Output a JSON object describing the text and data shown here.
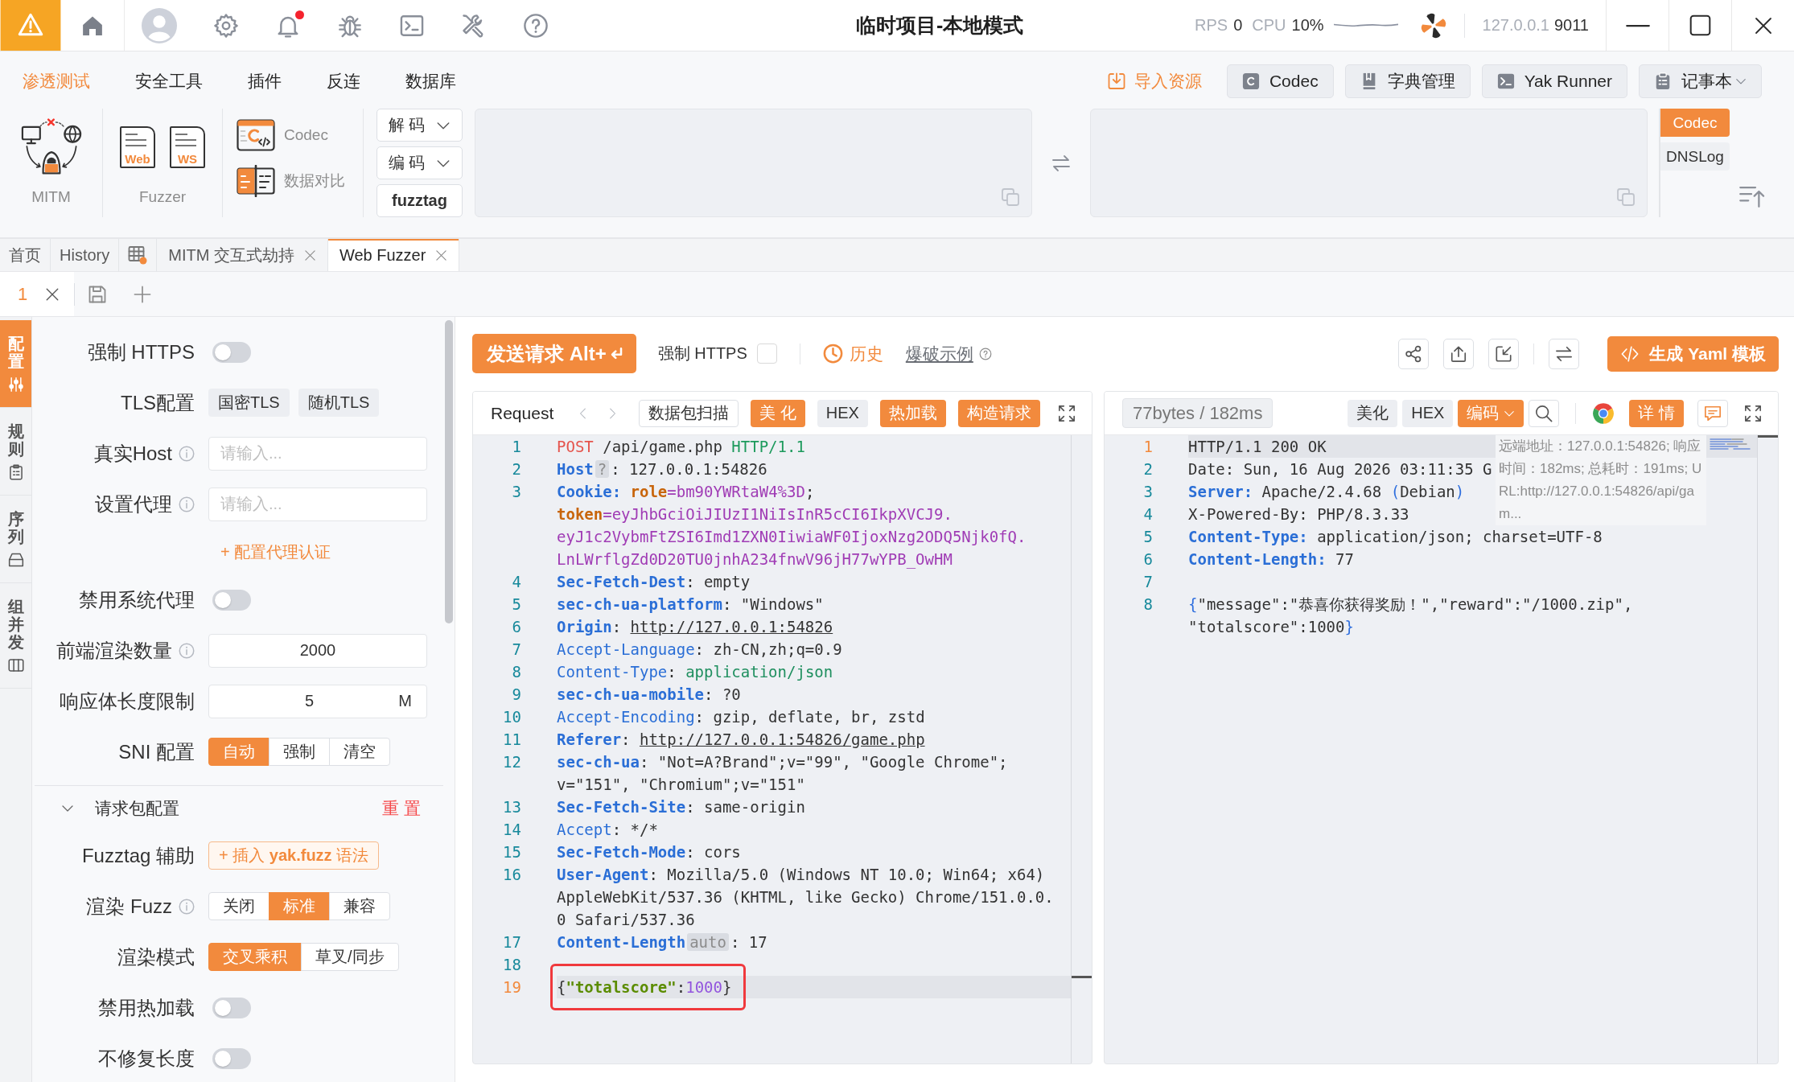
{
  "title_bar": {
    "title": "临时项目-本地模式",
    "unread_notifications": true,
    "stats": [
      {
        "label": "RPS",
        "value": "0"
      },
      {
        "label": "CPU",
        "value": "10%"
      }
    ],
    "engine": {
      "address": "127.0.0.1",
      "port": "9011"
    }
  },
  "menu": {
    "items": [
      {
        "label": "渗透测试",
        "selected": true
      },
      {
        "label": "安全工具",
        "selected": false
      },
      {
        "label": "插件",
        "selected": false
      },
      {
        "label": "反连",
        "selected": false
      },
      {
        "label": "数据库",
        "selected": false
      }
    ],
    "import_link": "导入资源",
    "buttons": [
      {
        "label": "Codec",
        "kind": "button"
      },
      {
        "label": "字典管理",
        "kind": "button"
      },
      {
        "label": "Yak Runner",
        "kind": "button"
      },
      {
        "label": "记事本",
        "kind": "dropdown"
      }
    ]
  },
  "toolbar": {
    "mitm": "MITM",
    "fuzzer": {
      "label": "Fuzzer",
      "items": [
        "Web",
        "WS"
      ]
    },
    "tools": [
      "Codec",
      "数据对比"
    ],
    "codec_actions": [
      {
        "label": "解 码",
        "kind": "dropdown"
      },
      {
        "label": "编 码",
        "kind": "dropdown"
      },
      {
        "label": "fuzztag",
        "kind": "button"
      }
    ],
    "side_tabs": [
      {
        "label": "Codec",
        "selected": true
      },
      {
        "label": "DNSLog",
        "selected": false
      }
    ]
  },
  "tabs": [
    {
      "kind": "text",
      "label": "首页",
      "selected": false,
      "closable": false
    },
    {
      "kind": "text",
      "label": "History",
      "selected": false,
      "closable": false
    },
    {
      "kind": "icon",
      "selected": false,
      "closable": false
    },
    {
      "kind": "text",
      "label": "MITM 交互式劫持",
      "selected": false,
      "closable": true
    },
    {
      "kind": "text",
      "label": "Web Fuzzer",
      "selected": true,
      "closable": true
    }
  ],
  "sub_tabs": [
    {
      "label": "1",
      "selected": true,
      "closable": true
    }
  ],
  "side_rail": [
    {
      "label": "配置",
      "selected": true
    },
    {
      "label": "规则",
      "selected": false
    },
    {
      "label": "序列",
      "selected": false
    },
    {
      "label": "组并发",
      "selected": false
    }
  ],
  "config": [
    {
      "kind": "toggle",
      "label": "强制 HTTPS",
      "on": false
    },
    {
      "kind": "chips",
      "label": "TLS配置",
      "options": [
        {
          "label": "国密TLS",
          "selected": false
        },
        {
          "label": "随机TLS",
          "selected": false
        }
      ]
    },
    {
      "kind": "input",
      "label": "真实Host",
      "info": true,
      "placeholder": "请输入..."
    },
    {
      "kind": "input",
      "label": "设置代理",
      "info": true,
      "placeholder": "请输入..."
    },
    {
      "kind": "link",
      "label": "+ 配置代理认证"
    },
    {
      "kind": "toggle",
      "label": "禁用系统代理",
      "on": false
    },
    {
      "kind": "input",
      "label": "前端渲染数量",
      "info": true,
      "value": "2000"
    },
    {
      "kind": "input",
      "label": "响应体长度限制",
      "value": "5",
      "suffix": "M"
    },
    {
      "kind": "segmented",
      "label": "SNI 配置",
      "options": [
        {
          "label": "自动",
          "selected": true
        },
        {
          "label": "强制",
          "selected": false
        },
        {
          "label": "清空",
          "selected": false
        }
      ]
    },
    {
      "kind": "section",
      "label": "请求包配置",
      "expanded": true,
      "action": "重 置"
    },
    {
      "kind": "button",
      "label": "Fuzztag 辅助",
      "button": [
        {
          "text": "+ 插入 ",
          "bold": false
        },
        {
          "text": "yak.fuzz",
          "bold": true
        },
        {
          "text": " 语法",
          "bold": false
        }
      ]
    },
    {
      "kind": "segmented",
      "label": "渲染 Fuzz",
      "info": true,
      "options": [
        {
          "label": "关闭",
          "selected": false
        },
        {
          "label": "标准",
          "selected": true
        },
        {
          "label": "兼容",
          "selected": false
        }
      ]
    },
    {
      "kind": "segmented",
      "label": "渲染模式",
      "options": [
        {
          "label": "交叉乘积",
          "selected": true
        },
        {
          "label": "草叉/同步",
          "selected": false
        }
      ]
    },
    {
      "kind": "toggle",
      "label": "禁用热加载",
      "on": false
    },
    {
      "kind": "toggle",
      "label": "不修复长度",
      "on": false
    }
  ],
  "send_bar": {
    "send_button": "发送请求 Alt+",
    "force_https": {
      "label": "强制 HTTPS",
      "checked": false
    },
    "history": "历史",
    "examples": "爆破示例",
    "yaml_button": "生成 Yaml 模板"
  },
  "request": {
    "title": "Request",
    "buttons": [
      {
        "label": "数据包扫描",
        "kind": "outline"
      },
      {
        "label": "美 化",
        "kind": "primary"
      },
      {
        "label": "HEX",
        "kind": "plain"
      },
      {
        "label": "热加载",
        "kind": "primary"
      },
      {
        "label": "构造请求",
        "kind": "primary"
      }
    ],
    "lines": [
      {
        "number": "1",
        "current": false,
        "boxed": false,
        "rows": [
          [
            {
              "kind": "method",
              "text": "POST"
            },
            {
              "kind": "plain",
              "text": " /api/game.php "
            },
            {
              "kind": "version",
              "text": "HTTP/1.1"
            }
          ]
        ]
      },
      {
        "number": "2",
        "current": false,
        "boxed": false,
        "rows": [
          [
            {
              "kind": "key_strong",
              "text": "Host"
            },
            {
              "kind": "hint",
              "text": "?"
            },
            {
              "kind": "plain",
              "text": ": 127.0.0.1:54826"
            }
          ]
        ]
      },
      {
        "number": "3",
        "current": false,
        "boxed": false,
        "rows": [
          [
            {
              "kind": "key_strong",
              "text": "Cookie:"
            },
            {
              "kind": "plain",
              "text": " "
            },
            {
              "kind": "cookie_name",
              "text": "role"
            },
            {
              "kind": "cookie_value",
              "text": "=bm90YWRtaW4%3D"
            },
            {
              "kind": "plain",
              "text": "; "
            }
          ],
          [
            {
              "kind": "cookie_name",
              "text": "token"
            },
            {
              "kind": "cookie_value",
              "text": "=eyJhbGciOiJIUzI1NiIsInR5cCI6IkpXVCJ9."
            }
          ],
          [
            {
              "kind": "cookie_value",
              "text": "eyJ1c2VybmFtZSI6Imd1ZXN0IiwiaWF0IjoxNzg2ODQ5Njk0fQ."
            }
          ],
          [
            {
              "kind": "cookie_value",
              "text": "LnLWrflgZd0D20TU0jnhA234fnwV96jH77wYPB_OwHM"
            }
          ]
        ]
      },
      {
        "number": "4",
        "current": false,
        "boxed": false,
        "rows": [
          [
            {
              "kind": "key_strong",
              "text": "Sec-Fetch-Dest"
            },
            {
              "kind": "plain",
              "text": ": empty"
            }
          ]
        ]
      },
      {
        "number": "5",
        "current": false,
        "boxed": false,
        "rows": [
          [
            {
              "kind": "key_strong",
              "text": "sec-ch-ua-platform"
            },
            {
              "kind": "plain",
              "text": ": \"Windows\""
            }
          ]
        ]
      },
      {
        "number": "6",
        "current": false,
        "boxed": false,
        "rows": [
          [
            {
              "kind": "key_strong",
              "text": "Origin"
            },
            {
              "kind": "plain",
              "text": ": "
            },
            {
              "kind": "link",
              "text": "http://127.0.0.1:54826"
            }
          ]
        ]
      },
      {
        "number": "7",
        "current": false,
        "boxed": false,
        "rows": [
          [
            {
              "kind": "key",
              "text": "Accept-Language"
            },
            {
              "kind": "plain",
              "text": ": zh-CN,zh;q=0.9"
            }
          ]
        ]
      },
      {
        "number": "8",
        "current": false,
        "boxed": false,
        "rows": [
          [
            {
              "kind": "key",
              "text": "Content-Type"
            },
            {
              "kind": "plain",
              "text": ": "
            },
            {
              "kind": "mime",
              "text": "application/json"
            }
          ]
        ]
      },
      {
        "number": "9",
        "current": false,
        "boxed": false,
        "rows": [
          [
            {
              "kind": "key_strong",
              "text": "sec-ch-ua-mobile"
            },
            {
              "kind": "plain",
              "text": ": ?0"
            }
          ]
        ]
      },
      {
        "number": "10",
        "current": false,
        "boxed": false,
        "rows": [
          [
            {
              "kind": "key",
              "text": "Accept-Encoding"
            },
            {
              "kind": "plain",
              "text": ": gzip, deflate, br, zstd"
            }
          ]
        ]
      },
      {
        "number": "11",
        "current": false,
        "boxed": false,
        "rows": [
          [
            {
              "kind": "key_strong",
              "text": "Referer"
            },
            {
              "kind": "plain",
              "text": ": "
            },
            {
              "kind": "link",
              "text": "http://127.0.0.1:54826/game.php"
            }
          ]
        ]
      },
      {
        "number": "12",
        "current": false,
        "boxed": false,
        "rows": [
          [
            {
              "kind": "key_strong",
              "text": "sec-ch-ua"
            },
            {
              "kind": "plain",
              "text": ": \"Not=A?Brand\";v=\"99\", \"Google Chrome\";"
            }
          ],
          [
            {
              "kind": "plain",
              "text": "v=\"151\", \"Chromium\";v=\"151\""
            }
          ]
        ]
      },
      {
        "number": "13",
        "current": false,
        "boxed": false,
        "rows": [
          [
            {
              "kind": "key_strong",
              "text": "Sec-Fetch-Site"
            },
            {
              "kind": "plain",
              "text": ": same-origin"
            }
          ]
        ]
      },
      {
        "number": "14",
        "current": false,
        "boxed": false,
        "rows": [
          [
            {
              "kind": "key",
              "text": "Accept"
            },
            {
              "kind": "plain",
              "text": ": */*"
            }
          ]
        ]
      },
      {
        "number": "15",
        "current": false,
        "boxed": false,
        "rows": [
          [
            {
              "kind": "key_strong",
              "text": "Sec-Fetch-Mode"
            },
            {
              "kind": "plain",
              "text": ": cors"
            }
          ]
        ]
      },
      {
        "number": "16",
        "current": false,
        "boxed": false,
        "rows": [
          [
            {
              "kind": "key_strong",
              "text": "User-Agent"
            },
            {
              "kind": "plain",
              "text": ": Mozilla/5.0 (Windows NT 10.0; Win64; x64)"
            }
          ],
          [
            {
              "kind": "plain",
              "text": "AppleWebKit/537.36 (KHTML, like Gecko) Chrome/151.0.0."
            }
          ],
          [
            {
              "kind": "plain",
              "text": "0 Safari/537.36"
            }
          ]
        ]
      },
      {
        "number": "17",
        "current": false,
        "boxed": false,
        "rows": [
          [
            {
              "kind": "key_strong",
              "text": "Content-Length"
            },
            {
              "kind": "hint",
              "text": "auto"
            },
            {
              "kind": "plain",
              "text": ": 17"
            }
          ]
        ]
      },
      {
        "number": "18",
        "current": false,
        "boxed": false,
        "rows": [
          []
        ]
      },
      {
        "number": "19",
        "current": true,
        "boxed": true,
        "rows": [
          [
            {
              "kind": "punct",
              "text": "{"
            },
            {
              "kind": "json_key",
              "text": "\"totalscore\""
            },
            {
              "kind": "punct",
              "text": ":"
            },
            {
              "kind": "json_number",
              "text": "1000"
            },
            {
              "kind": "punct",
              "text": "}"
            }
          ]
        ]
      }
    ]
  },
  "response": {
    "size": "77bytes / 182ms",
    "buttons": [
      {
        "label": "美化",
        "kind": "plain"
      },
      {
        "label": "HEX",
        "kind": "plain"
      },
      {
        "label": "编码",
        "kind": "dropdown"
      }
    ],
    "details": "详 情",
    "info": "远端地址：127.0.0.1:54826; 响应时间：182ms; 总耗时：191ms; URL:http://127.0.0.1:54826/api/gam...",
    "lines": [
      {
        "number": "1",
        "current": true,
        "boxed": false,
        "rows": [
          [
            {
              "kind": "plain",
              "text": "HTTP/1.1 200 OK"
            }
          ]
        ]
      },
      {
        "number": "2",
        "current": false,
        "boxed": false,
        "rows": [
          [
            {
              "kind": "plain",
              "text": "Date: Sun, 16 Aug 2026 03:11:35 G"
            }
          ]
        ]
      },
      {
        "number": "3",
        "current": false,
        "boxed": false,
        "rows": [
          [
            {
              "kind": "key_strong",
              "text": "Server:"
            },
            {
              "kind": "plain",
              "text": " Apache/2.4.68 "
            },
            {
              "kind": "bracket",
              "text": "("
            },
            {
              "kind": "plain",
              "text": "Debian"
            },
            {
              "kind": "bracket",
              "text": ")"
            }
          ]
        ]
      },
      {
        "number": "4",
        "current": false,
        "boxed": false,
        "rows": [
          [
            {
              "kind": "plain",
              "text": "X-Powered-By: PHP/8.3.33"
            }
          ]
        ]
      },
      {
        "number": "5",
        "current": false,
        "boxed": false,
        "rows": [
          [
            {
              "kind": "key_strong",
              "text": "Content-Type:"
            },
            {
              "kind": "plain",
              "text": " application/json; charset=UTF-8"
            }
          ]
        ]
      },
      {
        "number": "6",
        "current": false,
        "boxed": false,
        "rows": [
          [
            {
              "kind": "key_strong",
              "text": "Content-Length:"
            },
            {
              "kind": "plain",
              "text": " 77"
            }
          ]
        ]
      },
      {
        "number": "7",
        "current": false,
        "boxed": false,
        "rows": [
          []
        ]
      },
      {
        "number": "8",
        "current": false,
        "boxed": false,
        "rows": [
          [
            {
              "kind": "bracket",
              "text": "{"
            },
            {
              "kind": "plain",
              "text": "\"message\":\"恭喜你获得奖励！\",\"reward\":\"/1000.zip\","
            }
          ],
          [
            {
              "kind": "plain",
              "text": "\"totalscore\":1000"
            },
            {
              "kind": "bracket",
              "text": "}"
            }
          ]
        ]
      }
    ]
  }
}
